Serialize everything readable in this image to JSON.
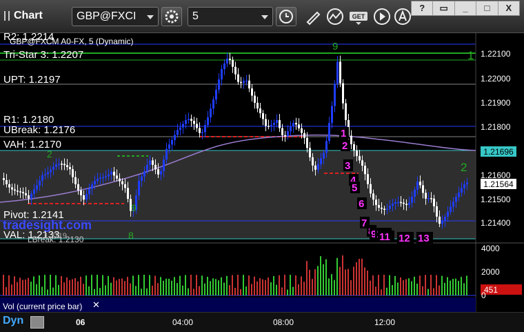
{
  "toolbar": {
    "title": "Chart",
    "symbol": "GBP@FXCI",
    "interval": "5",
    "get_label": "GET"
  },
  "window": {
    "help": "?",
    "restore": "",
    "minimize": "",
    "maximize": "",
    "close": "X"
  },
  "chart": {
    "header": "GBP@FXCM A0-FX, 5 (Dynamic)",
    "levels": {
      "r2": "R2: 1.2214",
      "tristar": "Tri-Star 3: 1.2207",
      "upt": "UPT: 1.2197",
      "r1": "R1: 1.2180",
      "ubreak": "UBreak: 1.2176",
      "vah": "VAH: 1.2170",
      "pivot": "Pivot: 1.2141",
      "val": "VAL: 1.2133",
      "lbreak": "LBreak: 1.2130",
      "lbreak_extra": "1.2119"
    },
    "watermark": "tradesight.com",
    "price_ticks": [
      "1.22100",
      "1.22000",
      "1.21900",
      "1.21800",
      "1.21600",
      "1.21500",
      "1.21400"
    ],
    "price_badges": {
      "vah_value": "1.21696",
      "last_value": "1.21564"
    },
    "time_ticks": [
      "06",
      "04:00",
      "08:00",
      "12:00"
    ],
    "volume_ticks": [
      "4000",
      "2000",
      "0"
    ],
    "volume_badge": "451",
    "volume_label": "Vol (current price bar)",
    "seq_numbers": [
      "1",
      "2",
      "3",
      "4",
      "5",
      "6",
      "7",
      "8",
      "9",
      "10",
      "11",
      "12",
      "13"
    ],
    "green_marks": [
      "9",
      "1",
      "2",
      "8",
      "9",
      "2"
    ],
    "status": "Dyn",
    "colors": {
      "up_bar": "#1f3dff",
      "down_bar": "#ffffff",
      "vah_line": "#37c7c7",
      "level_line": "#2a3aff",
      "vwap": "#9a7cd0",
      "seq": "#ff33ff",
      "tristar": "#22aa22",
      "vol_up": "#33cc33",
      "vol_down": "#cc3333",
      "badge_red": "#cc1111"
    }
  }
}
